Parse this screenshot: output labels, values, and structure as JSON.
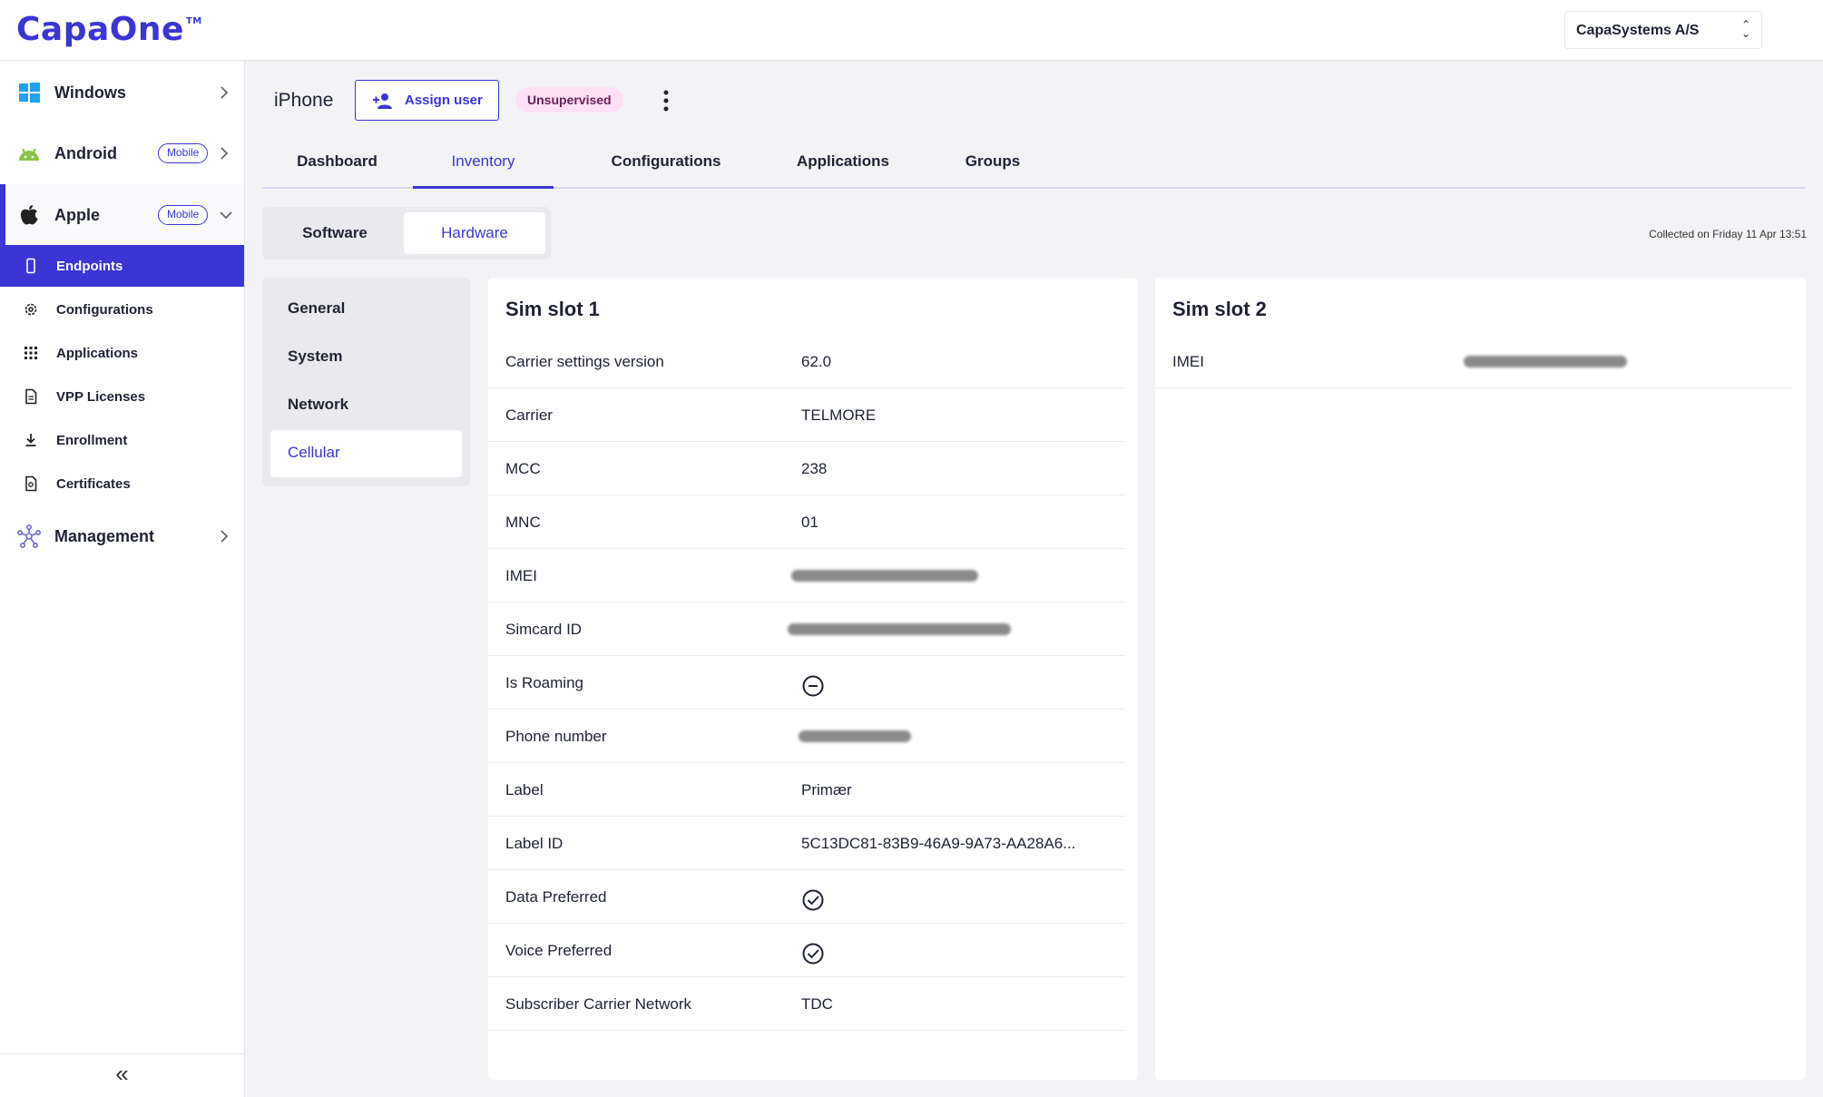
{
  "app": {
    "logo": "CapaOne",
    "logo_tm": "TM"
  },
  "org_selector": {
    "value": "CapaSystems A/S"
  },
  "sidebar": {
    "groups": [
      {
        "label": "Windows"
      },
      {
        "label": "Android",
        "badge": "Mobile"
      },
      {
        "label": "Apple",
        "badge": "Mobile"
      },
      {
        "label": "Management"
      }
    ],
    "apple_items": [
      {
        "label": "Endpoints"
      },
      {
        "label": "Configurations"
      },
      {
        "label": "Applications"
      },
      {
        "label": "VPP Licenses"
      },
      {
        "label": "Enrollment"
      },
      {
        "label": "Certificates"
      }
    ],
    "collapse": "«"
  },
  "header": {
    "device": "iPhone",
    "assign_label": "Assign user",
    "status": "Unsupervised"
  },
  "tabs": [
    "Dashboard",
    "Inventory",
    "Configurations",
    "Applications",
    "Groups"
  ],
  "segment": [
    "Software",
    "Hardware"
  ],
  "collected": "Collected on Friday 11 Apr 13:51",
  "categories": [
    "General",
    "System",
    "Network",
    "Cellular"
  ],
  "sim1": {
    "title": "Sim slot 1",
    "rows": [
      {
        "key": "Carrier settings version",
        "value": "62.0"
      },
      {
        "key": "Carrier",
        "value": "TELMORE"
      },
      {
        "key": "MCC",
        "value": "238"
      },
      {
        "key": "MNC",
        "value": "01"
      },
      {
        "key": "IMEI",
        "value": ""
      },
      {
        "key": "Simcard ID",
        "value": ""
      },
      {
        "key": "Is Roaming",
        "icon": "minus-circle-icon"
      },
      {
        "key": "Phone number",
        "value": ""
      },
      {
        "key": "Label",
        "value": "Primær"
      },
      {
        "key": "Label ID",
        "value": "5C13DC81-83B9-46A9-9A73-AA28A6..."
      },
      {
        "key": "Data Preferred",
        "icon": "check-circle-icon"
      },
      {
        "key": "Voice Preferred",
        "icon": "check-circle-icon"
      },
      {
        "key": "Subscriber Carrier Network",
        "value": "TDC"
      }
    ]
  },
  "sim2": {
    "title": "Sim slot 2",
    "rows": [
      {
        "key": "IMEI",
        "value": ""
      }
    ]
  },
  "colors": {
    "accent": "#3b35d6",
    "pill_bg": "#fde0f5",
    "pill_text": "#6a1f58"
  }
}
